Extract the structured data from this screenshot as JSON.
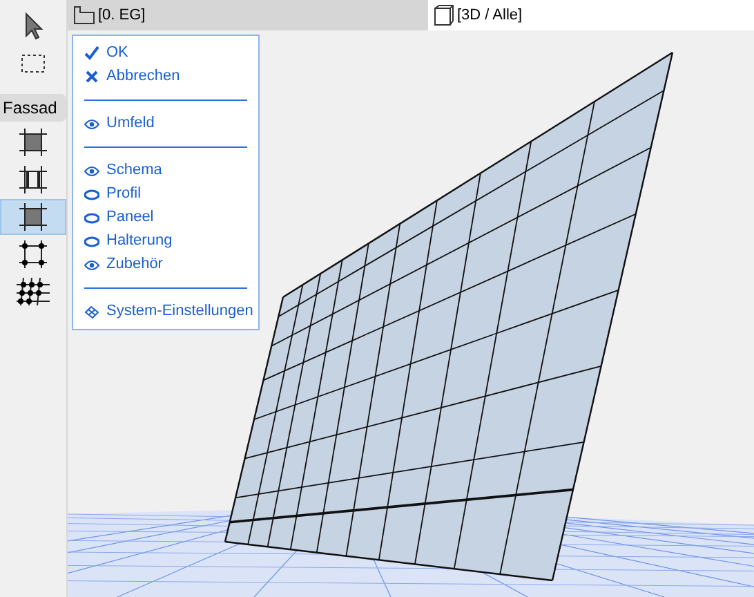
{
  "toolbox": {
    "tools": [
      {
        "kind": "arrow",
        "selected": false
      },
      {
        "kind": "marquee",
        "selected": false
      }
    ],
    "section_label": "Fassad",
    "section_tools": [
      {
        "kind": "panel",
        "selected": false
      },
      {
        "kind": "frame",
        "selected": false
      },
      {
        "kind": "panel",
        "selected": true
      },
      {
        "kind": "grid",
        "selected": false
      },
      {
        "kind": "multi",
        "selected": false
      }
    ]
  },
  "tabs": [
    {
      "label": "[0. EG]",
      "kind": "plan",
      "selected": false
    },
    {
      "label": "[3D / Alle]",
      "kind": "perspective",
      "selected": true
    }
  ],
  "menu": {
    "groups": [
      [
        {
          "kind": "check",
          "label": "OK"
        },
        {
          "kind": "cross",
          "label": "Abbrechen"
        }
      ],
      [
        {
          "kind": "eye",
          "label": "Umfeld",
          "visible": true
        }
      ],
      [
        {
          "kind": "eye",
          "label": "Schema",
          "visible": true
        },
        {
          "kind": "eye",
          "label": "Profil",
          "visible": false
        },
        {
          "kind": "eye",
          "label": "Paneel",
          "visible": false
        },
        {
          "kind": "eye",
          "label": "Halterung",
          "visible": false
        },
        {
          "kind": "eye",
          "label": "Zubehör",
          "visible": true
        }
      ],
      [
        {
          "kind": "settings",
          "label": "System-Einstellungen"
        }
      ]
    ]
  }
}
